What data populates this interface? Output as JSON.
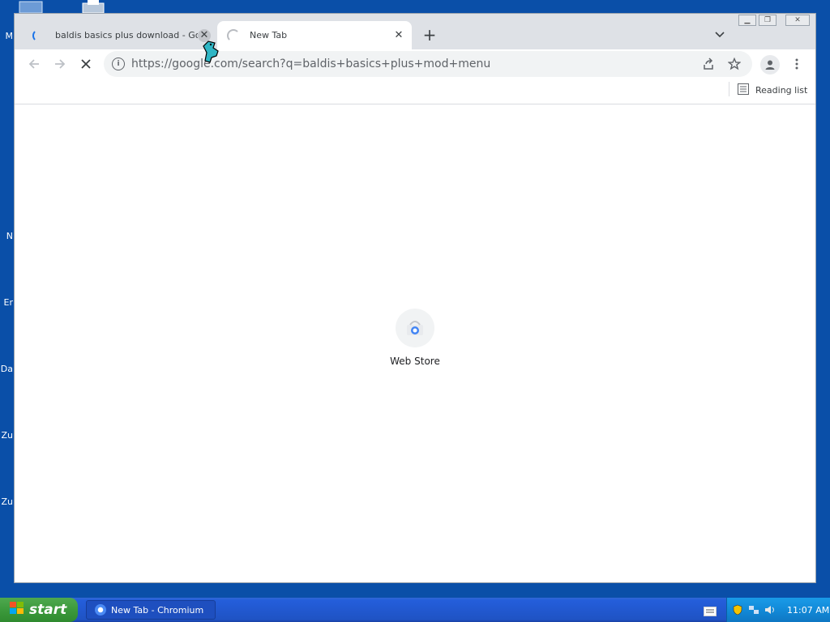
{
  "desktop": {
    "labels": [
      "M",
      "N",
      "Er",
      "Da",
      "Zu",
      "Zu"
    ]
  },
  "browser": {
    "tabs": [
      {
        "title": "baldis basics plus download - Google Search",
        "loading": true,
        "active": false
      },
      {
        "title": "New Tab",
        "loading": true,
        "active": true
      }
    ],
    "address": "https://google.com/search?q=baldis+basics+plus+mod+menu",
    "bookmarks_bar": {
      "reading_list_label": "Reading list"
    },
    "ntp": {
      "shortcuts": [
        {
          "label": "Web Store"
        }
      ]
    },
    "icons": [
      "back-icon",
      "forward-icon",
      "stop-icon",
      "info-icon",
      "share-icon",
      "star-icon",
      "profile-icon",
      "menu-icon",
      "tab-search-icon",
      "new-tab-icon",
      "reading-list-icon"
    ]
  },
  "taskbar": {
    "start_label": "start",
    "items": [
      {
        "label": "New Tab - Chromium"
      }
    ],
    "clock": "11:07 AM"
  },
  "colors": {
    "desktop_bg": "#0a4fa8",
    "tabstrip_bg": "#dee1e6",
    "accent": "#1a73e8",
    "taskbar_blue": "#245edb",
    "start_green": "#3c9a3c"
  }
}
